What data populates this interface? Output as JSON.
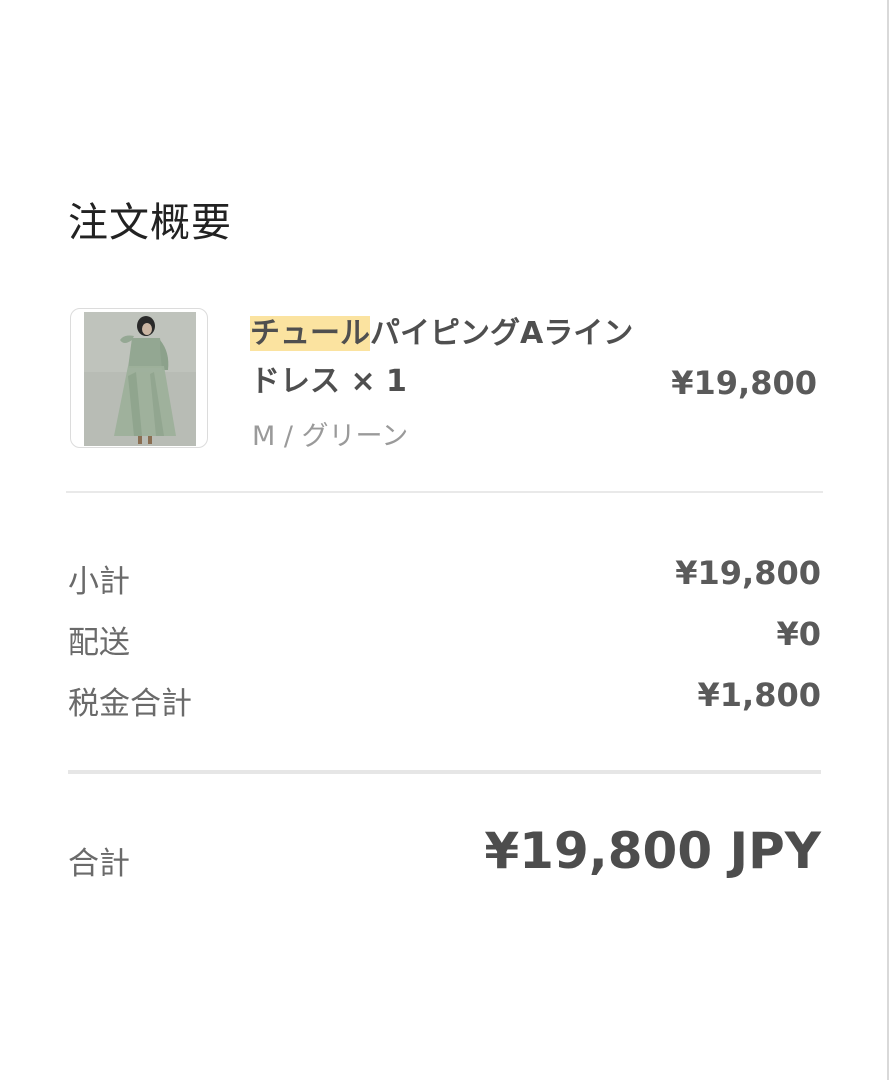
{
  "summary": {
    "title": "注文概要"
  },
  "item": {
    "name_highlight": "チュール",
    "name_rest": "パイピングAラインドレス × 1",
    "variant": "M / グリーン",
    "price": "¥19,800"
  },
  "totals": {
    "subtotal_label": "小計",
    "subtotal_value": "¥19,800",
    "shipping_label": "配送",
    "shipping_value": "¥0",
    "tax_label": "税金合計",
    "tax_value": "¥1,800",
    "total_label": "合計",
    "total_value": "¥19,800 JPY"
  },
  "colors": {
    "highlight": "#fbe3a0",
    "dress_green": "#8fa38f"
  }
}
